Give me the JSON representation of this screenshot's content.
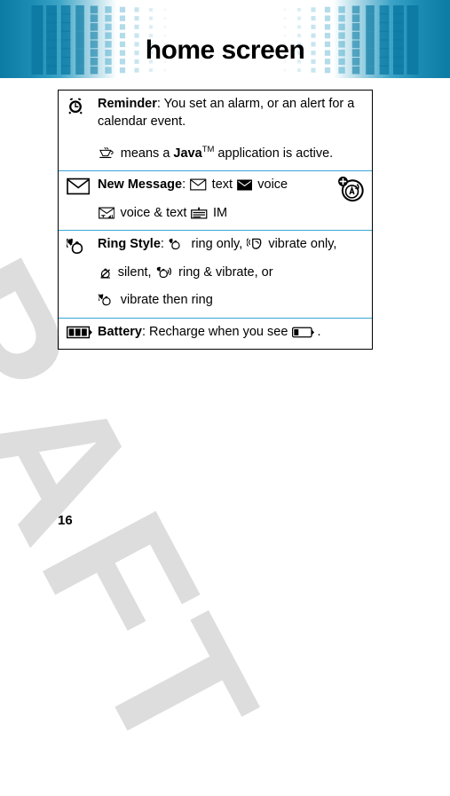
{
  "header": {
    "title": "home screen",
    "pattern_color_dark": "#0d7ba4",
    "pattern_color_mid": "#3ba3c6",
    "pattern_color_light": "#bfe0ee"
  },
  "watermark": {
    "text": "DRAFT",
    "color": "#d8d8d8"
  },
  "table": {
    "border_color": "#000000",
    "row_divider_color": "#3aa5d8",
    "rows": [
      {
        "id": "reminder",
        "icon": "alarm-clock-icon",
        "paragraphs": [
          {
            "segments": [
              {
                "type": "bold",
                "text": "Reminder"
              },
              {
                "type": "text",
                "text": ": You set an alarm, or an alert for a calendar event."
              }
            ]
          },
          {
            "segments": [
              {
                "type": "icon",
                "icon": "java-coffee-cup-icon"
              },
              {
                "type": "text",
                "text": " means a "
              },
              {
                "type": "bold",
                "text": "Java"
              },
              {
                "type": "sup",
                "text": "TM"
              },
              {
                "type": "text",
                "text": " application is active."
              }
            ]
          }
        ]
      },
      {
        "id": "new-message",
        "icon": "envelope-outline-icon",
        "badge_icon": "alert-plus-icon",
        "paragraphs": [
          {
            "segments": [
              {
                "type": "bold",
                "text": "New Message"
              },
              {
                "type": "text",
                "text": ": "
              },
              {
                "type": "icon",
                "icon": "envelope-outline-icon"
              },
              {
                "type": "text",
                "text": " text "
              },
              {
                "type": "icon",
                "icon": "envelope-filled-icon"
              },
              {
                "type": "text",
                "text": " voice"
              }
            ]
          },
          {
            "segments": [
              {
                "type": "icon",
                "icon": "envelope-voice-text-icon"
              },
              {
                "type": "text",
                "text": " voice & text "
              },
              {
                "type": "icon",
                "icon": "im-message-icon"
              },
              {
                "type": "text",
                "text": " IM"
              }
            ]
          }
        ]
      },
      {
        "id": "ring-style",
        "icon": "vibrate-then-ring-icon",
        "paragraphs": [
          {
            "segments": [
              {
                "type": "bold",
                "text": "Ring Style"
              },
              {
                "type": "text",
                "text": ": "
              },
              {
                "type": "icon",
                "icon": "ring-only-icon"
              },
              {
                "type": "text",
                "text": " ring only, "
              },
              {
                "type": "icon",
                "icon": "vibrate-only-icon"
              },
              {
                "type": "text",
                "text": " vibrate only,"
              }
            ]
          },
          {
            "segments": [
              {
                "type": "icon",
                "icon": "silent-icon"
              },
              {
                "type": "text",
                "text": " silent, "
              },
              {
                "type": "icon",
                "icon": "ring-and-vibrate-icon"
              },
              {
                "type": "text",
                "text": " ring & vibrate, or"
              }
            ]
          },
          {
            "segments": [
              {
                "type": "icon",
                "icon": "vibrate-then-ring-icon"
              },
              {
                "type": "text",
                "text": " vibrate then ring"
              }
            ]
          }
        ]
      },
      {
        "id": "battery",
        "icon": "battery-full-icon",
        "paragraphs": [
          {
            "segments": [
              {
                "type": "bold",
                "text": "Battery"
              },
              {
                "type": "text",
                "text": ": Recharge when you see "
              },
              {
                "type": "icon",
                "icon": "battery-low-icon"
              },
              {
                "type": "text",
                "text": "."
              }
            ]
          }
        ]
      }
    ]
  },
  "footer": {
    "page_number": "16"
  }
}
